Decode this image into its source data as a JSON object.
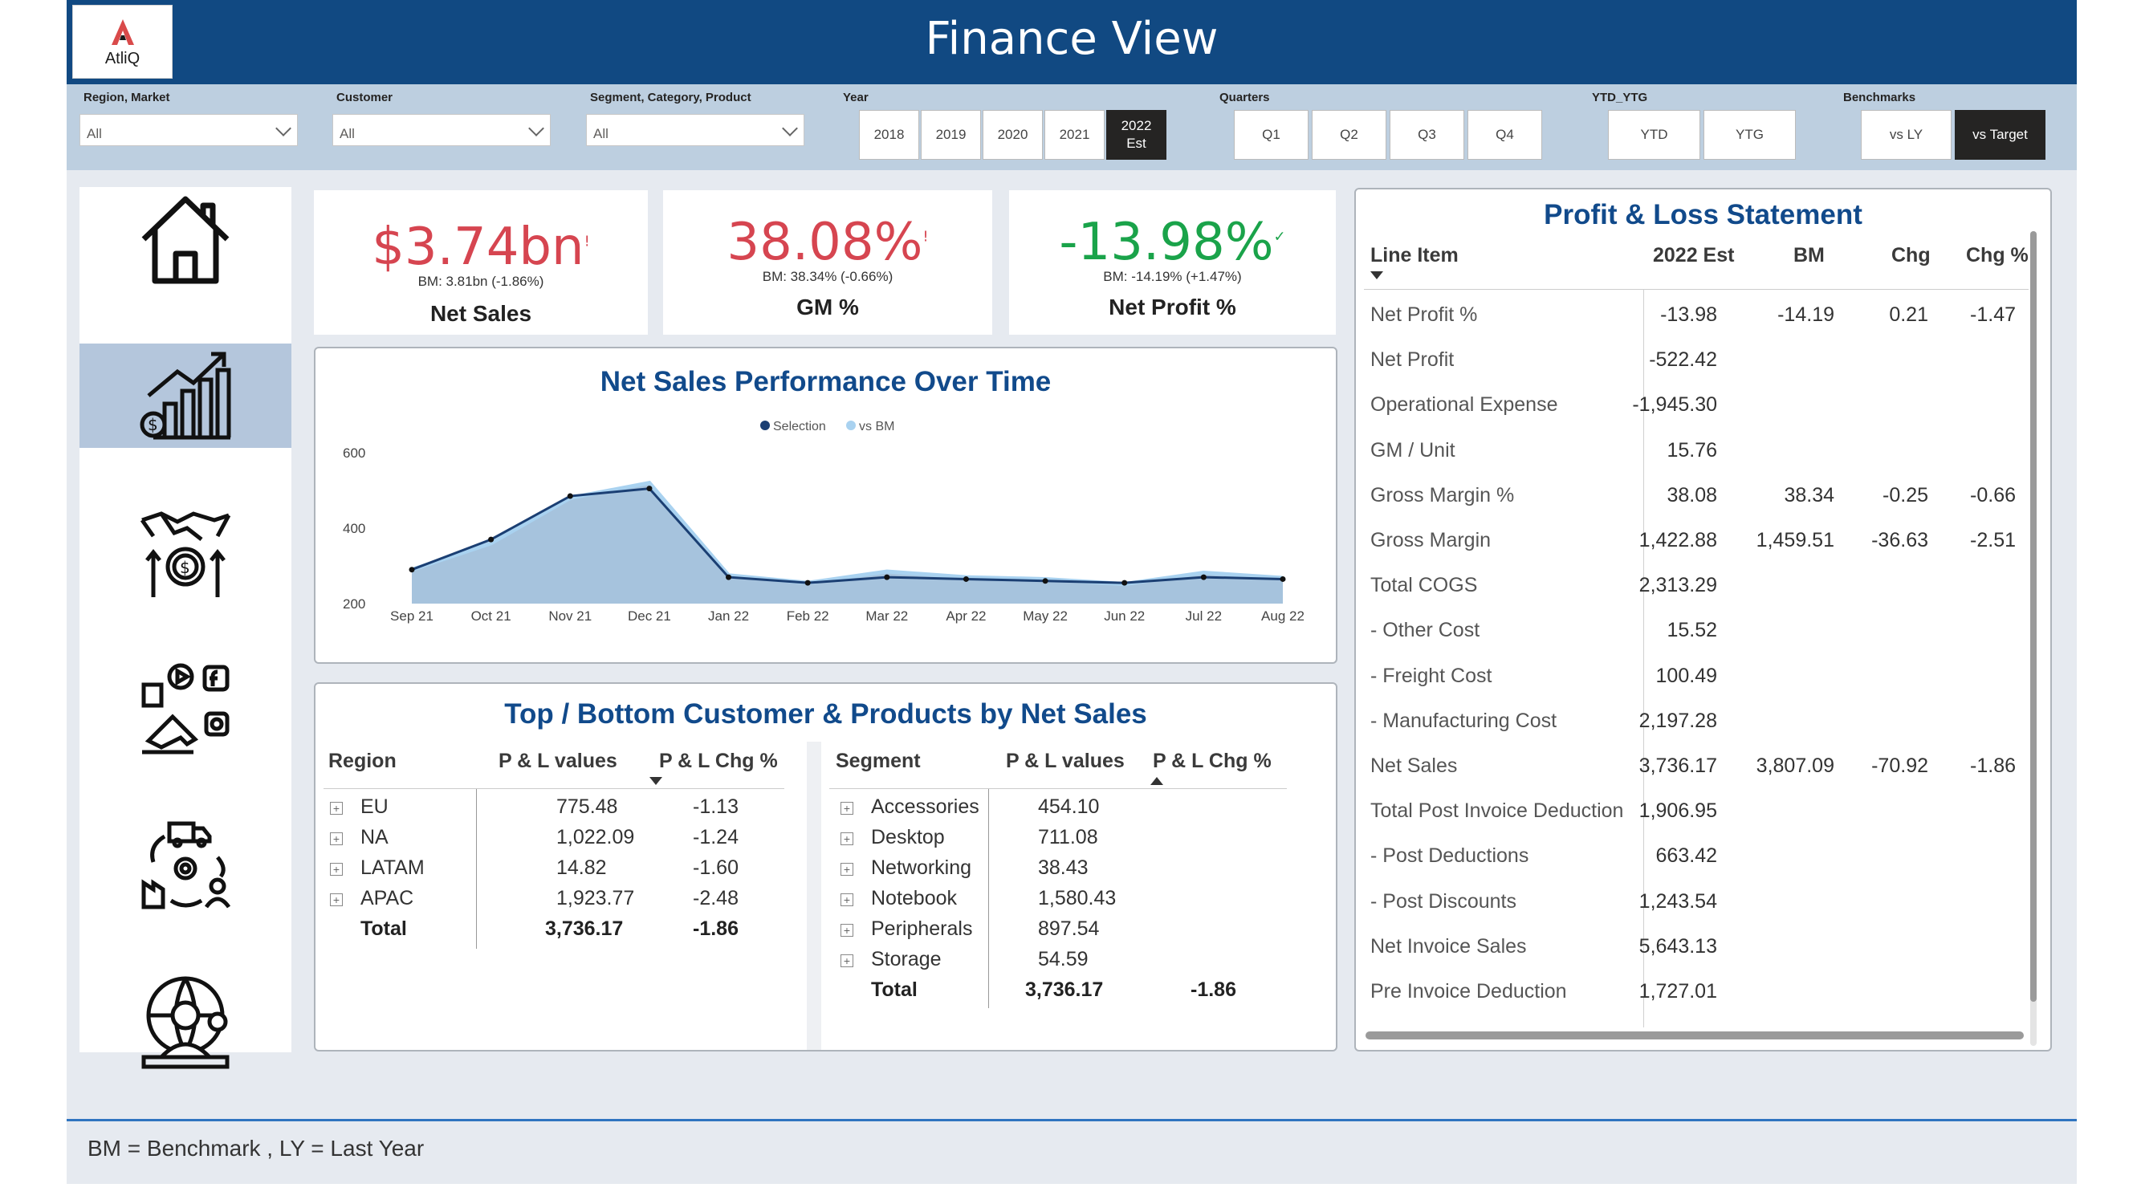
{
  "header": {
    "title": "Finance View",
    "logo_text": "AtliQ"
  },
  "filters": {
    "region_label": "Region, Market",
    "region_value": "All",
    "customer_label": "Customer",
    "customer_value": "All",
    "segment_label": "Segment, Category, Product",
    "segment_value": "All",
    "year_label": "Year",
    "years": [
      "2018",
      "2019",
      "2020",
      "2021"
    ],
    "year_selected_line1": "2022",
    "year_selected_line2": "Est",
    "quarters_label": "Quarters",
    "quarters": [
      "Q1",
      "Q2",
      "Q3",
      "Q4"
    ],
    "ytd_label": "YTD_YTG",
    "ytd_options": [
      "YTD",
      "YTG"
    ],
    "benchmarks_label": "Benchmarks",
    "benchmark_options": [
      "vs LY",
      "vs Target"
    ],
    "benchmark_selected": "vs Target"
  },
  "nav": [
    "home-icon",
    "finance-growth-icon",
    "sales-handshake-icon",
    "marketing-icon",
    "supply-chain-icon",
    "executive-icon"
  ],
  "kpis": [
    {
      "value": "$3.74bn",
      "bm": "BM: 3.81bn (-1.86%)",
      "name": "Net Sales",
      "color": "#d64550",
      "mark": "!"
    },
    {
      "value": "38.08%",
      "bm": "BM: 38.34% (-0.66%)",
      "name": "GM %",
      "color": "#d64550",
      "mark": "!"
    },
    {
      "value": "-13.98%",
      "bm": "BM: -14.19% (+1.47%)",
      "name": "Net Profit %",
      "color": "#1aa34a",
      "mark": "✓"
    }
  ],
  "chart_data": {
    "type": "area",
    "title": "Net Sales Performance Over Time",
    "categories": [
      "Sep 21",
      "Oct 21",
      "Nov 21",
      "Dec 21",
      "Jan 22",
      "Feb 22",
      "Mar 22",
      "Apr 22",
      "May 22",
      "Jun 22",
      "Jul 22",
      "Aug 22"
    ],
    "series": [
      {
        "name": "Selection",
        "values": [
          290,
          370,
          485,
          505,
          270,
          255,
          270,
          265,
          260,
          255,
          270,
          265
        ]
      },
      {
        "name": "vs BM",
        "values": [
          290,
          360,
          480,
          520,
          275,
          255,
          285,
          270,
          265,
          252,
          282,
          268
        ]
      }
    ],
    "yticks": [
      "600",
      "400",
      "200"
    ],
    "ylim": [
      200,
      600
    ],
    "legend_position": "top-center",
    "colors": {
      "selection": "#1b3f73",
      "bm": "#a9d2f0",
      "fill": "#a6c3dd"
    }
  },
  "topbottom": {
    "title": "Top / Bottom Customer & Products by Net Sales",
    "region": {
      "headers": [
        "Region",
        "P & L values",
        "P & L Chg %"
      ],
      "rows": [
        {
          "name": "EU",
          "value": "775.48",
          "chg": "-1.13"
        },
        {
          "name": "NA",
          "value": "1,022.09",
          "chg": "-1.24"
        },
        {
          "name": "LATAM",
          "value": "14.82",
          "chg": "-1.60"
        },
        {
          "name": "APAC",
          "value": "1,923.77",
          "chg": "-2.48"
        }
      ],
      "total": {
        "name": "Total",
        "value": "3,736.17",
        "chg": "-1.86"
      }
    },
    "segment": {
      "headers": [
        "Segment",
        "P & L values",
        "P & L Chg %"
      ],
      "rows": [
        {
          "name": "Accessories",
          "value": "454.10"
        },
        {
          "name": "Desktop",
          "value": "711.08"
        },
        {
          "name": "Networking",
          "value": "38.43"
        },
        {
          "name": "Notebook",
          "value": "1,580.43"
        },
        {
          "name": "Peripherals",
          "value": "897.54"
        },
        {
          "name": "Storage",
          "value": "54.59"
        }
      ],
      "total": {
        "name": "Total",
        "value": "3,736.17",
        "chg": "-1.86"
      }
    }
  },
  "pl": {
    "title": "Profit & Loss Statement",
    "headers": [
      "Line Item",
      "2022 Est",
      "BM",
      "Chg",
      "Chg %"
    ],
    "rows": [
      {
        "item": "Net Profit %",
        "est": "-13.98",
        "bm": "-14.19",
        "chg": "0.21",
        "chgp": "-1.47"
      },
      {
        "item": "Net Profit",
        "est": "-522.42",
        "bm": "",
        "chg": "",
        "chgp": ""
      },
      {
        "item": "Operational Expense",
        "est": "-1,945.30",
        "bm": "",
        "chg": "",
        "chgp": ""
      },
      {
        "item": "GM / Unit",
        "est": "15.76",
        "bm": "",
        "chg": "",
        "chgp": ""
      },
      {
        "item": "Gross Margin %",
        "est": "38.08",
        "bm": "38.34",
        "chg": "-0.25",
        "chgp": "-0.66"
      },
      {
        "item": "Gross Margin",
        "est": "1,422.88",
        "bm": "1,459.51",
        "chg": "-36.63",
        "chgp": "-2.51"
      },
      {
        "item": "Total COGS",
        "est": "2,313.29",
        "bm": "",
        "chg": "",
        "chgp": ""
      },
      {
        "item": "- Other Cost",
        "est": "15.52",
        "bm": "",
        "chg": "",
        "chgp": ""
      },
      {
        "item": "- Freight Cost",
        "est": "100.49",
        "bm": "",
        "chg": "",
        "chgp": ""
      },
      {
        "item": "- Manufacturing Cost",
        "est": "2,197.28",
        "bm": "",
        "chg": "",
        "chgp": ""
      },
      {
        "item": "Net Sales",
        "est": "3,736.17",
        "bm": "3,807.09",
        "chg": "-70.92",
        "chgp": "-1.86"
      },
      {
        "item": "Total Post Invoice Deduction",
        "est": "1,906.95",
        "bm": "",
        "chg": "",
        "chgp": ""
      },
      {
        "item": "- Post Deductions",
        "est": "663.42",
        "bm": "",
        "chg": "",
        "chgp": ""
      },
      {
        "item": "- Post Discounts",
        "est": "1,243.54",
        "bm": "",
        "chg": "",
        "chgp": ""
      },
      {
        "item": "Net Invoice Sales",
        "est": "5,643.13",
        "bm": "",
        "chg": "",
        "chgp": ""
      },
      {
        "item": "Pre Invoice Deduction",
        "est": "1,727.01",
        "bm": "",
        "chg": "",
        "chgp": ""
      }
    ]
  },
  "footer": {
    "text": "BM = Benchmark , LY = Last Year"
  }
}
